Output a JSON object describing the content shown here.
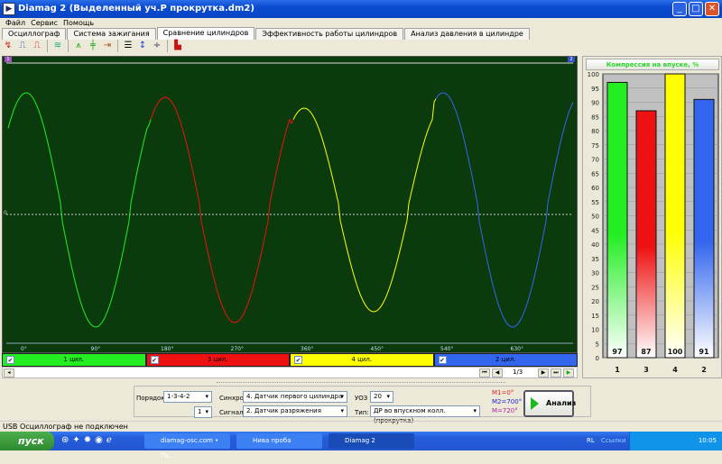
{
  "window": {
    "title": "Diamag 2 (Выделенный уч.Р прокрутка.dm2)",
    "minimize": "_",
    "maximize": "□",
    "close": "✕"
  },
  "menu": [
    "Файл",
    "Сервис",
    "Помощь"
  ],
  "tabs": [
    "Осциллограф",
    "Система зажигания",
    "Сравнение цилиндров",
    "Эффективность работы цилиндров",
    "Анализ давления в цилиндре"
  ],
  "active_tab": 2,
  "plot": {
    "x_ticks": [
      "0°",
      "90°",
      "180°",
      "270°",
      "360°",
      "450°",
      "540°",
      "630°"
    ],
    "marker_left": "1",
    "marker_right": "2",
    "zero_label": "0",
    "background": "#0b3b0d"
  },
  "cylinders": [
    {
      "label": "1 цил.",
      "color": "#22ee22"
    },
    {
      "label": "3 цил.",
      "color": "#ee1111"
    },
    {
      "label": "4 цил.",
      "color": "#ffff00"
    },
    {
      "label": "2 цил.",
      "color": "#3366ee"
    }
  ],
  "nav": {
    "page": "1/3"
  },
  "chart_data": {
    "type": "bar",
    "title": "Компрессия на впуске, %",
    "categories": [
      "1",
      "3",
      "4",
      "2"
    ],
    "values": [
      97,
      87,
      100,
      91
    ],
    "colors": [
      "#22ee22",
      "#ee1111",
      "#ffff00",
      "#3366ee"
    ],
    "ylim": [
      0,
      100
    ],
    "yticks": [
      0,
      5,
      10,
      15,
      20,
      25,
      30,
      35,
      40,
      45,
      50,
      55,
      60,
      65,
      70,
      75,
      80,
      85,
      90,
      95,
      100
    ],
    "grid": true
  },
  "controls": {
    "order_label": "Порядок",
    "order_value": "1-3-4-2",
    "order_num": "1",
    "sync_label": "Синхро:",
    "sync_value": "4. Датчик первого цилиндра",
    "signal_label": "Сигнал:",
    "signal_value": "2. Датчик разряжения",
    "uoz_label": "УОЗ",
    "uoz_value": "20",
    "type_label": "Тип:",
    "type_value": "ДР во впускном колл. (прокрутка)",
    "m1": "M1=0°",
    "m2": "M2=700°",
    "m": "M=720°",
    "analyze": "Анализ"
  },
  "status": "USB Осциллограф не подключен",
  "taskbar": {
    "start": "пуск",
    "tasks": [
      "diamag-osc.com • Пр...",
      "Нива проба",
      "Diamag 2"
    ],
    "lang": "RL",
    "links": "Ссылки",
    "time": "10:05"
  }
}
